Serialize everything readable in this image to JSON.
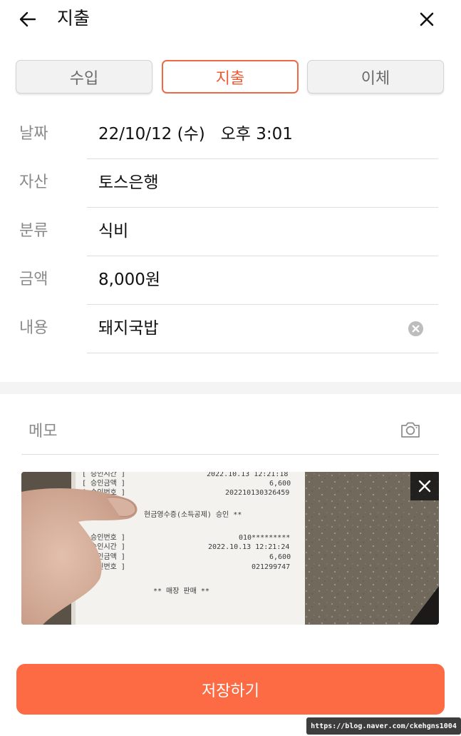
{
  "header": {
    "title": "지출",
    "back_icon": "arrow-left-icon",
    "close_icon": "close-icon"
  },
  "tabs": [
    {
      "label": "수입",
      "active": false
    },
    {
      "label": "지출",
      "active": true
    },
    {
      "label": "이체",
      "active": false
    }
  ],
  "form": {
    "date": {
      "label": "날짜",
      "value": "22/10/12 (수)   오후 3:01"
    },
    "asset": {
      "label": "자산",
      "value": "토스은행"
    },
    "category": {
      "label": "분류",
      "value": "식비"
    },
    "amount": {
      "label": "금액",
      "value": "8,000원"
    },
    "content": {
      "label": "내용",
      "value": "돼지국밥"
    }
  },
  "memo": {
    "placeholder": "메모",
    "camera_icon": "camera-icon"
  },
  "photo": {
    "receipt_lines": [
      "[ 승인시간 ]",
      "2022.10.13 12:21:18",
      "[ 승인금액 ]",
      "6,600",
      "[ 승인번호 ]",
      "202210130326459",
      "현금영수증(소득공제) 승인 **",
      "[ 승인번호 ]",
      "010*********",
      "[ 승인시간 ]",
      "2022.10.13 12:21:24",
      "[ 승인금액 ]",
      "6,600",
      "[ 승인번호 ]",
      "021299747",
      "** 매장 판매 **"
    ],
    "remove_icon": "close-icon"
  },
  "save_button": {
    "label": "저장하기"
  },
  "watermark": "https://blog.naver.com/ckehgns1004",
  "colors": {
    "accent": "#fd6b45",
    "tab_active_border": "#ef6a44",
    "tab_active_text": "#ef5a32",
    "label_gray": "#8a8a8a",
    "divider": "#dedede"
  }
}
